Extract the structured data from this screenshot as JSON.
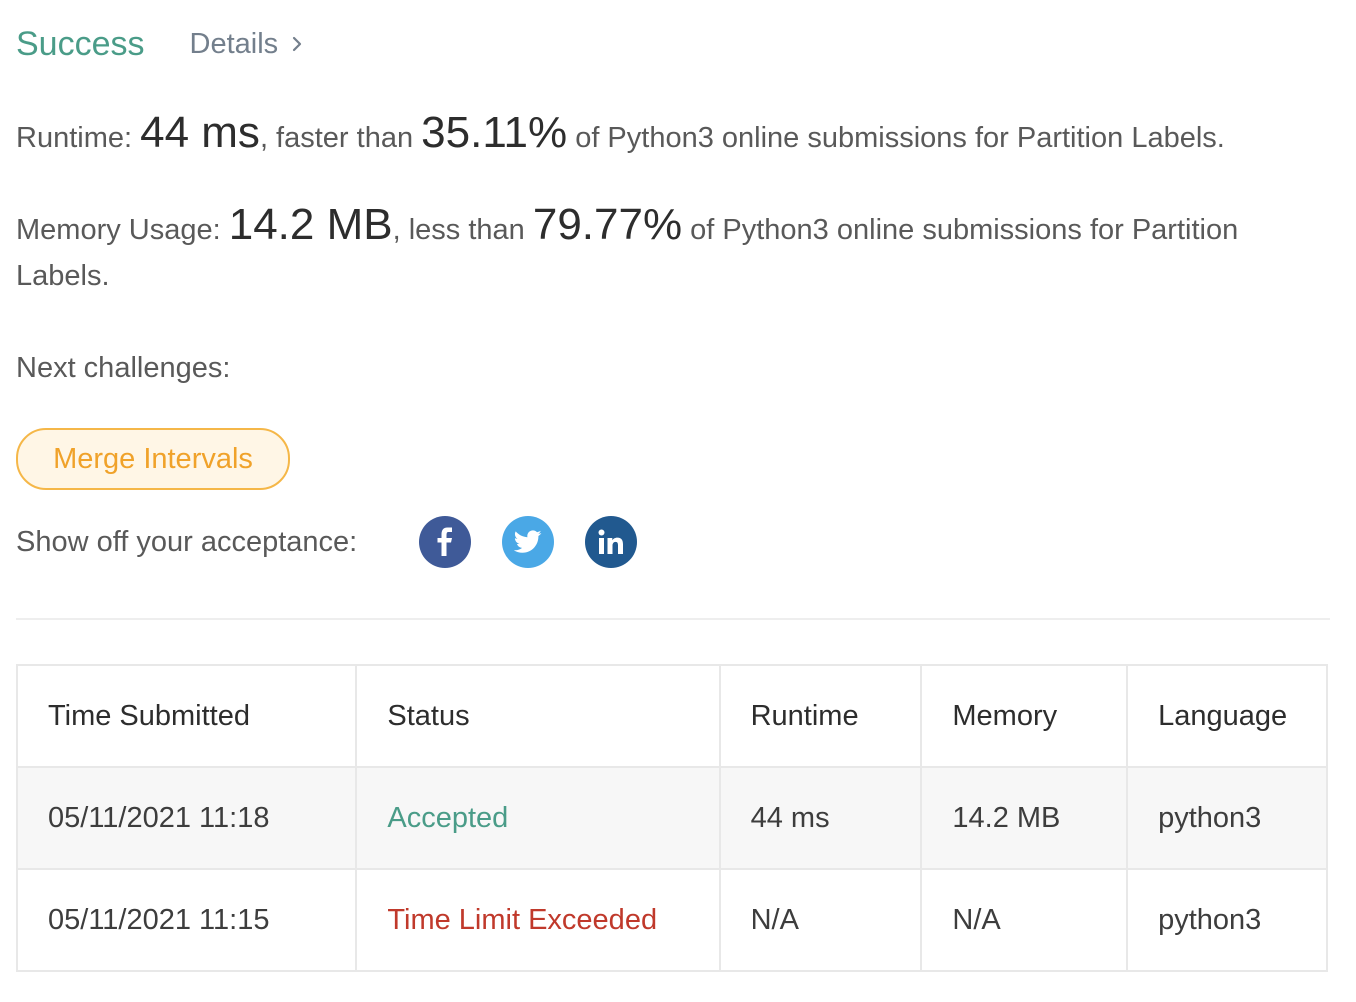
{
  "header": {
    "status": "Success",
    "details_label": "Details",
    "details_icon": "chevron-right-icon"
  },
  "runtime_line": {
    "label": "Runtime:",
    "value": "44 ms",
    "mid": ", faster than",
    "percent": "35.11%",
    "suffix": "of Python3 online submissions for Partition Labels."
  },
  "memory_line": {
    "label": "Memory Usage:",
    "value": "14.2 MB",
    "mid": ", less than",
    "percent": "79.77%",
    "suffix": "of Python3 online submissions for Partition Labels."
  },
  "next": {
    "title": "Next challenges:",
    "items": [
      {
        "label": "Merge Intervals"
      }
    ]
  },
  "share": {
    "label": "Show off your acceptance:",
    "icons": [
      "facebook-icon",
      "twitter-icon",
      "linkedin-icon"
    ]
  },
  "colors": {
    "success": "#4a9c88",
    "accepted": "#4a9c88",
    "time_limit_exceeded": "#c0392b",
    "chip_border": "#f5b748",
    "chip_text": "#f0a22a",
    "facebook": "#3f5a98",
    "twitter": "#4aa8e6",
    "linkedin": "#21598f"
  },
  "table": {
    "headers": [
      "Time Submitted",
      "Status",
      "Runtime",
      "Memory",
      "Language"
    ],
    "rows": [
      {
        "time": "05/11/2021 11:18",
        "status": "Accepted",
        "runtime": "44 ms",
        "memory": "14.2 MB",
        "language": "python3"
      },
      {
        "time": "05/11/2021 11:15",
        "status": "Time Limit Exceeded",
        "runtime": "N/A",
        "memory": "N/A",
        "language": "python3"
      }
    ]
  }
}
